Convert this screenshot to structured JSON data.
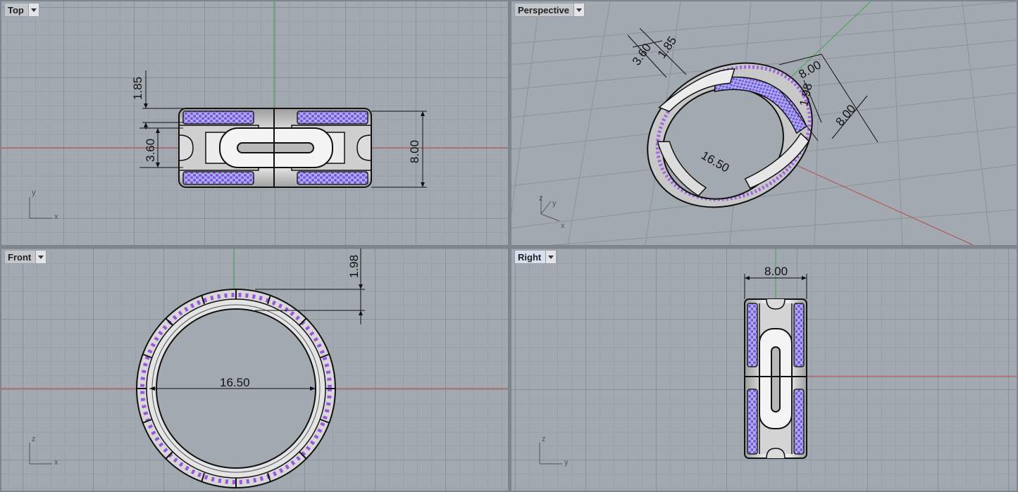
{
  "viewports": {
    "top": {
      "label": "Top",
      "dims": {
        "d1": "1.85",
        "d2": "3.60",
        "d3": "8.00"
      },
      "axes": {
        "a": "y",
        "b": "x"
      }
    },
    "perspective": {
      "label": "Perspective",
      "dims": {
        "d1": "3.60",
        "d2": "1.85",
        "d3": "8.00",
        "d4": "1.98",
        "d5": "8.00",
        "d6": "16.50"
      },
      "axes": {
        "a": "z",
        "b": "y",
        "c": "x"
      }
    },
    "front": {
      "label": "Front",
      "dims": {
        "d1": "1.98",
        "d2": "16.50"
      },
      "axes": {
        "a": "z",
        "b": "x"
      }
    },
    "right": {
      "label": "Right",
      "dims": {
        "d1": "8.00"
      },
      "axes": {
        "a": "z",
        "b": "y"
      }
    }
  },
  "icons": {
    "dropdown": "chevron-down-icon"
  },
  "colors": {
    "x_axis": "#b84a4a",
    "y_axis": "#3fa84a",
    "stones": "#a06ae0",
    "ring_metal": "#dadada"
  }
}
